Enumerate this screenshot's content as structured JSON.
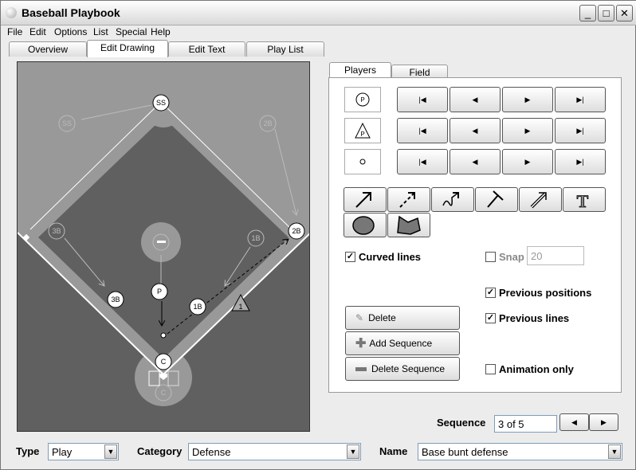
{
  "window": {
    "title": "Baseball Playbook",
    "minimize": "_",
    "maximize": "□",
    "close": "✕"
  },
  "menu": [
    "File",
    "Edit",
    "Options",
    "List",
    "Special",
    "Help"
  ],
  "tabs": [
    {
      "label": "Overview"
    },
    {
      "label": "Edit Drawing",
      "active": true
    },
    {
      "label": "Edit Text"
    },
    {
      "label": "Play List"
    }
  ],
  "field": {
    "players_current": [
      "SS",
      "2B",
      "3B",
      "P",
      "1B",
      "C"
    ],
    "players_previous": [
      "SS",
      "2B",
      "3B",
      "1B",
      "C"
    ],
    "marker": "1",
    "colors": {
      "grass": "#606060",
      "dirt": "#999999",
      "lines": "#ffffff"
    }
  },
  "panel": {
    "tabs": [
      {
        "label": "Players",
        "active": true
      },
      {
        "label": "Field"
      }
    ],
    "samples": [
      {
        "icon": "player-circle",
        "label": "P"
      },
      {
        "icon": "player-triangle",
        "label": "P"
      },
      {
        "icon": "ball"
      }
    ],
    "nav_buttons": [
      "first-icon",
      "prev-icon",
      "next-icon",
      "last-icon"
    ],
    "nav_glyphs": [
      "|◀",
      "◀",
      "▶",
      "▶|"
    ],
    "tools": [
      "arrow-icon",
      "dashed-arrow-icon",
      "curvy-arrow-icon",
      "block-line-icon",
      "double-arrow-icon",
      "text-icon",
      "ellipse-icon",
      "polygon-icon"
    ],
    "curved_lines": {
      "label": "Curved lines",
      "checked": true
    },
    "snap": {
      "label": "Snap",
      "checked": false,
      "value": "20"
    },
    "previous_positions": {
      "label": "Previous positions",
      "checked": true
    },
    "previous_lines": {
      "label": "Previous lines",
      "checked": true
    },
    "animation_only": {
      "label": "Animation only",
      "checked": false
    },
    "delete": "Delete",
    "add_sequence": "Add Sequence",
    "delete_sequence": "Delete Sequence"
  },
  "sequence": {
    "label": "Sequence",
    "value": "3 of 5"
  },
  "bottom": {
    "type_label": "Type",
    "type_value": "Play",
    "category_label": "Category",
    "category_value": "Defense",
    "name_label": "Name",
    "name_value": "Base bunt defense"
  }
}
